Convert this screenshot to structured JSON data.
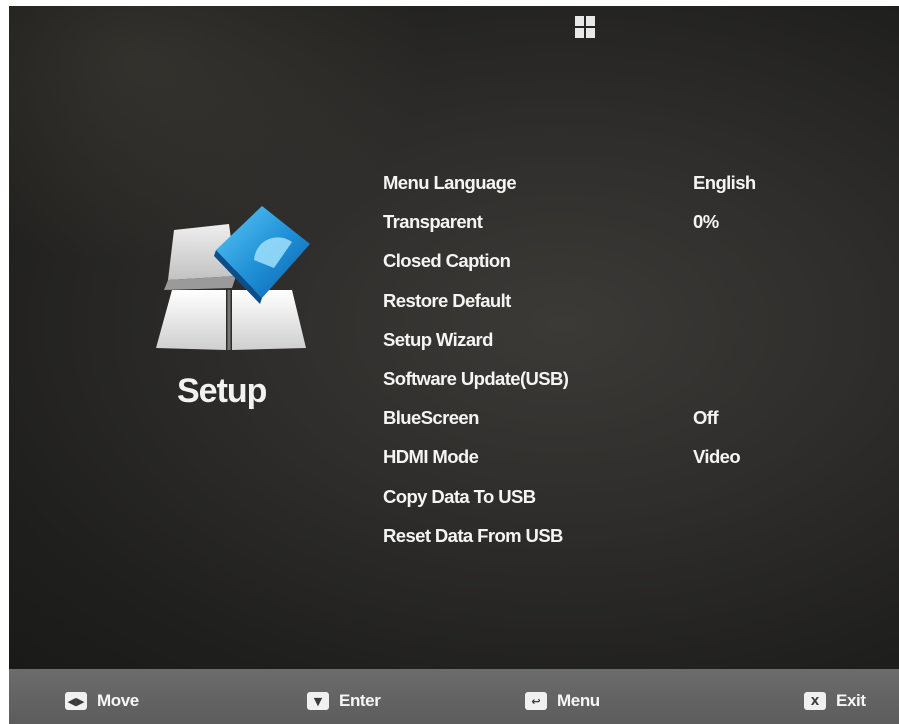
{
  "category": {
    "title": "Setup"
  },
  "menu": {
    "items": [
      {
        "label": "Menu Language",
        "value": "English"
      },
      {
        "label": "Transparent",
        "value": "0%"
      },
      {
        "label": "Closed Caption",
        "value": ""
      },
      {
        "label": "Restore Default",
        "value": ""
      },
      {
        "label": "Setup Wizard",
        "value": ""
      },
      {
        "label": "Software Update(USB)",
        "value": ""
      },
      {
        "label": "BlueScreen",
        "value": "Off"
      },
      {
        "label": "HDMI Mode",
        "value": "Video"
      },
      {
        "label": "Copy Data To USB",
        "value": ""
      },
      {
        "label": "Reset Data From USB",
        "value": ""
      }
    ]
  },
  "footer": {
    "move": {
      "key_icon": "arrows-left-right-icon",
      "label": "Move"
    },
    "enter": {
      "key_icon": "arrow-down-icon",
      "label": "Enter"
    },
    "menu": {
      "key_icon": "return-arrow-icon",
      "label": "Menu"
    },
    "exit": {
      "key_icon": "x-key-icon",
      "label": "Exit"
    }
  },
  "top_icon": "app-grid-icon",
  "colors": {
    "background": "#2e2d2b",
    "text": "#f4f4f4",
    "bottom_bar": "#656565",
    "accent_blue": "#1e8fd6"
  }
}
